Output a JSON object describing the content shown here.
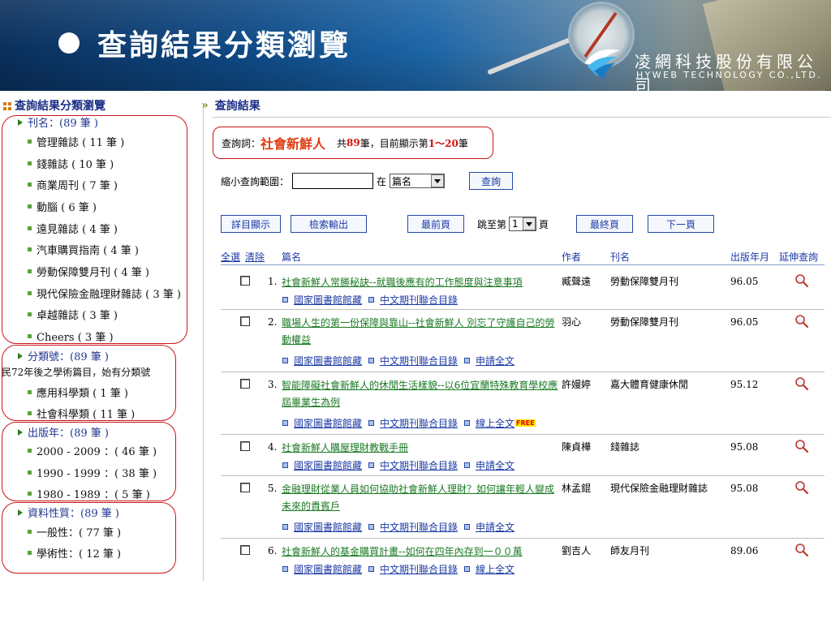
{
  "banner": {
    "title": "查詢結果分類瀏覽",
    "company_cn": "凌網科技股份有限公司",
    "company_en": "HYWEB TECHNOLOGY CO.,LTD."
  },
  "sidebar": {
    "heading": "查詢結果分類瀏覽",
    "groups": [
      {
        "title": "刊名：(89 筆 )",
        "items": [
          "管理雜誌 ( 11 筆 )",
          "錢雜誌 ( 10 筆 )",
          "商業周刊 ( 7 筆 )",
          "動腦 ( 6 筆 )",
          "遠見雜誌 ( 4 筆 )",
          "汽車購買指南 ( 4 筆 )",
          "勞動保障雙月刊 ( 4 筆 )",
          "現代保險金融理財雜誌 ( 3 筆 )",
          "卓越雜誌 ( 3 筆 )",
          "Cheers ( 3 筆 )"
        ]
      },
      {
        "title": "分類號：(89 筆 )",
        "note": "民72年後之學術篇目，始有分類號",
        "items": [
          "應用科學類 ( 1 筆 )",
          "社會科學類 ( 11 筆 )"
        ]
      },
      {
        "title": "出版年：(89 筆 )",
        "items": [
          "2000 - 2009 ：( 46 筆 )",
          "1990 - 1999 ：( 38 筆 )",
          "1980 - 1989 ：( 5 筆 )"
        ]
      },
      {
        "title": "資料性質：(89 筆 )",
        "items": [
          "一般性：( 77 筆 )",
          "學術性：( 12 筆 )"
        ]
      }
    ]
  },
  "results": {
    "heading": "查詢結果",
    "query": {
      "label": "查詢詞：",
      "term": "社會新鮮人",
      "prefix": "共",
      "count": "89",
      "middle": "筆，目前顯示第 ",
      "range": "1～20",
      "suffix": " 筆"
    },
    "narrow": {
      "label": "縮小查詢範圍：",
      "input_value": "",
      "in_label": "在",
      "field": "篇名",
      "search": "查詢"
    },
    "nav": {
      "detail": "詳目顯示",
      "export": "檢索輸出",
      "first": "最前頁",
      "jump_prefix": "跳至第",
      "page": "1",
      "jump_suffix": "頁",
      "last": "最終頁",
      "next": "下一頁"
    },
    "columns": {
      "select_all": "全選",
      "clear": "清除",
      "title": "篇名",
      "author": "作者",
      "journal": "刊名",
      "date": "出版年月",
      "extend": "延伸查詢"
    },
    "records": [
      {
        "num": "1.",
        "title": "社會新鮮人常勝秘訣--就職後應有的工作態度與注意事項",
        "author": "臧聲遠",
        "journal": "勞動保障雙月刊",
        "date": "96.05",
        "links": [
          "國家圖書館館藏",
          "中文期刊聯合目錄"
        ]
      },
      {
        "num": "2.",
        "title": "職場人生的第一份保障與靠山--社會新鮮人 別忘了守護自己的勞動權益",
        "author": "羽心",
        "journal": "勞動保障雙月刊",
        "date": "96.05",
        "links": [
          "國家圖書館館藏",
          "中文期刊聯合目錄",
          "申請全文"
        ]
      },
      {
        "num": "3.",
        "title": "智能障礙社會新鮮人的休閒生活樣貌--以6位宜蘭特殊教育學校應屆畢業生為例",
        "author": "許嫚婷",
        "journal": "嘉大體育健康休閒",
        "date": "95.12",
        "links": [
          "國家圖書館館藏",
          "中文期刊聯合目錄",
          "線上全文"
        ],
        "badge": "FREE"
      },
      {
        "num": "4.",
        "title": "社會新鮮人購屋理財教戰手冊",
        "author": "陳貞樺",
        "journal": "錢雜誌",
        "date": "95.08",
        "links": [
          "國家圖書館館藏",
          "中文期刊聯合目錄",
          "申請全文"
        ]
      },
      {
        "num": "5.",
        "title": "金融理財從業人員如何協助社會新鮮人理財？如何讓年輕人變成未來的貴賓戶",
        "author": "林孟錕",
        "journal": "現代保險金融理財雜誌",
        "date": "95.08",
        "links": [
          "國家圖書館館藏",
          "中文期刊聯合目錄",
          "申請全文"
        ]
      },
      {
        "num": "6.",
        "title": "社會新鮮人的基金購買計畫--如何在四年內存到一００萬",
        "author": "劉吉人",
        "journal": "師友月刊",
        "date": "89.06",
        "links": [
          "國家圖書館館藏",
          "中文期刊聯合目錄",
          "線上全文"
        ]
      }
    ]
  },
  "icons": {
    "magnifier": "search-magnifier-icon",
    "group_arrow": "arrow-right-icon",
    "item_bullet": "bullet-icon"
  },
  "colors": {
    "banner_blue": "#0f4a86",
    "heading_blue": "#1c2f86",
    "link_green": "#1b7a24",
    "link_blue": "#1c3aa4",
    "highlight_red": "#d2100a",
    "box_red": "#c8151b"
  }
}
